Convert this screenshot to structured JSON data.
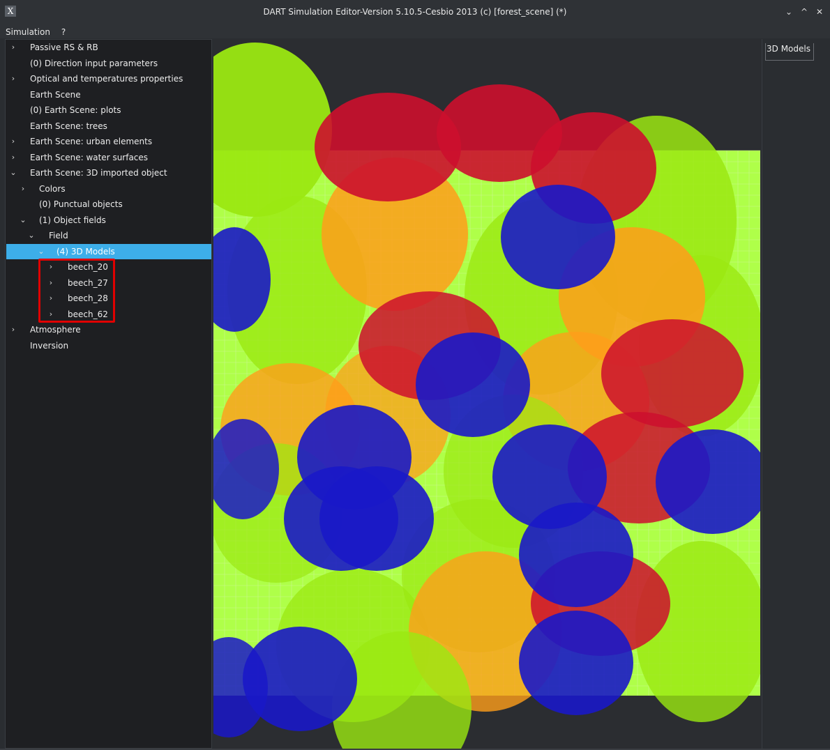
{
  "window": {
    "title": "DART Simulation Editor-Version 5.10.5-Cesbio 2013 (c) [forest_scene] (*)",
    "app_icon": "X",
    "controls": [
      "⌄",
      "^",
      "✕"
    ]
  },
  "menu": {
    "items": [
      "Simulation",
      "?"
    ]
  },
  "tree": {
    "items": [
      {
        "label": "Passive RS & RB",
        "depth": 0,
        "expander": "collapsed"
      },
      {
        "label": "(0) Direction input parameters",
        "depth": 0,
        "expander": "none"
      },
      {
        "label": "Optical and temperatures properties",
        "depth": 0,
        "expander": "collapsed"
      },
      {
        "label": "Earth Scene",
        "depth": 0,
        "expander": "none"
      },
      {
        "label": "(0) Earth Scene: plots",
        "depth": 0,
        "expander": "none"
      },
      {
        "label": "Earth Scene: trees",
        "depth": 0,
        "expander": "none"
      },
      {
        "label": "Earth Scene: urban elements",
        "depth": 0,
        "expander": "collapsed"
      },
      {
        "label": "Earth Scene: water surfaces",
        "depth": 0,
        "expander": "collapsed"
      },
      {
        "label": "Earth Scene: 3D imported object",
        "depth": 0,
        "expander": "expanded"
      },
      {
        "label": "Colors",
        "depth": 1,
        "expander": "collapsed"
      },
      {
        "label": "(0) Punctual objects",
        "depth": 1,
        "expander": "none"
      },
      {
        "label": "(1) Object fields",
        "depth": 1,
        "expander": "expanded"
      },
      {
        "label": "Field",
        "depth": 2,
        "expander": "expanded"
      },
      {
        "label": "(4) 3D Models",
        "depth": 3,
        "expander": "expanded",
        "selected": true
      },
      {
        "label": "beech_20",
        "depth": 4,
        "expander": "collapsed"
      },
      {
        "label": "beech_27",
        "depth": 4,
        "expander": "collapsed"
      },
      {
        "label": "beech_28",
        "depth": 4,
        "expander": "collapsed"
      },
      {
        "label": "beech_62",
        "depth": 4,
        "expander": "collapsed"
      },
      {
        "label": "Atmosphere",
        "depth": 0,
        "expander": "collapsed"
      },
      {
        "label": "Inversion",
        "depth": 0,
        "expander": "none"
      }
    ]
  },
  "right_panel": {
    "tab_label": "3D Models"
  },
  "scene": {
    "colors": {
      "ground": "#a8ff3a",
      "grid": "#c9f78f",
      "white": "#ffffff",
      "green": "#9be812",
      "orange": "#ff9d1a",
      "red": "#cc0f2e",
      "blue": "#1a18c8",
      "selection": "#3daee9",
      "highlight": "#e00000"
    }
  }
}
